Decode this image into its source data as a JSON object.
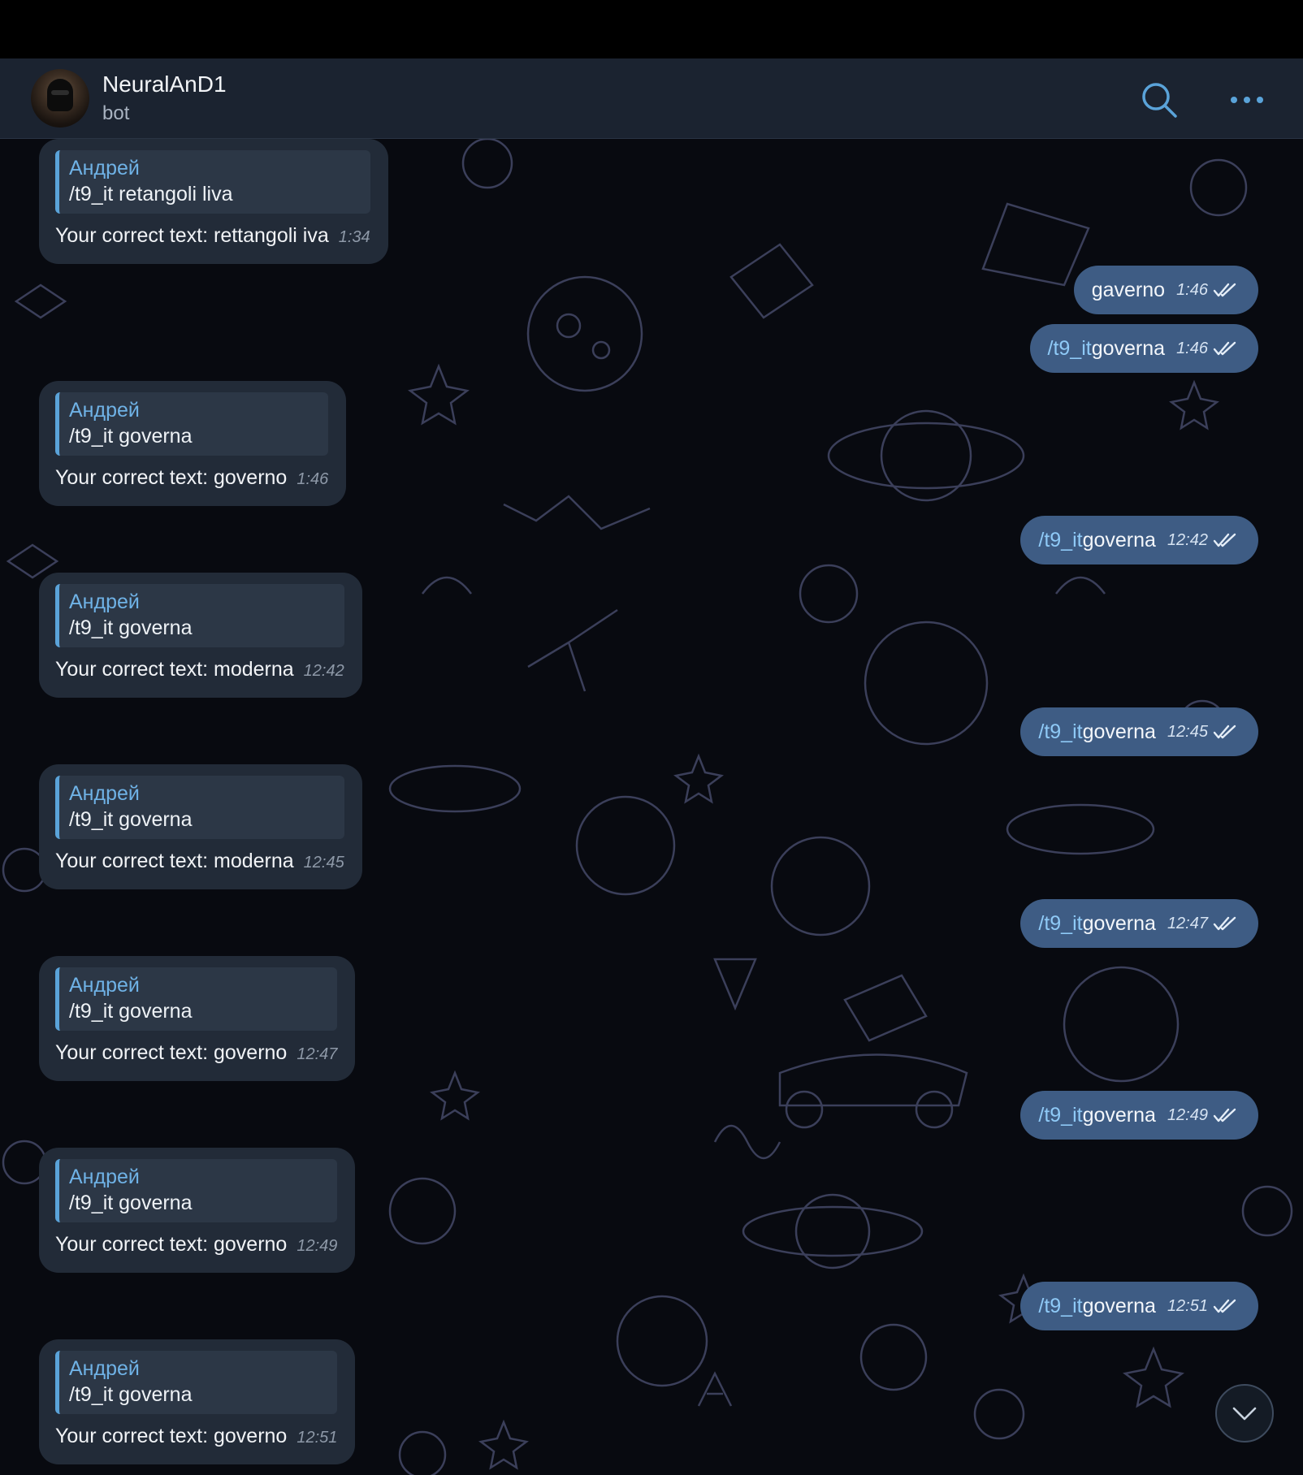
{
  "header": {
    "name": "NeuralAnD1",
    "status": "bot"
  },
  "incoming": [
    {
      "reply_name": "Андрей",
      "reply_text": "/t9_it retangoli liva",
      "text": "Your correct text: rettangoli iva",
      "time": "1:34"
    },
    {
      "reply_name": "Андрей",
      "reply_text": "/t9_it governa",
      "text": "Your correct text: governo",
      "time": "1:46"
    },
    {
      "reply_name": "Андрей",
      "reply_text": "/t9_it governa",
      "text": "Your correct text: moderna",
      "time": "12:42"
    },
    {
      "reply_name": "Андрей",
      "reply_text": "/t9_it governa",
      "text": "Your correct text: moderna",
      "time": "12:45"
    },
    {
      "reply_name": "Андрей",
      "reply_text": "/t9_it governa",
      "text": "Your correct text: governo",
      "time": "12:47"
    },
    {
      "reply_name": "Андрей",
      "reply_text": "/t9_it governa",
      "text": "Your correct text: governo",
      "time": "12:49"
    },
    {
      "reply_name": "Андрей",
      "reply_text": "/t9_it governa",
      "text": "Your correct text: governo",
      "time": "12:51"
    }
  ],
  "outgoing": [
    {
      "command": "",
      "text": "gaverno",
      "time": "1:46"
    },
    {
      "command": "/t9_it",
      "text": " governa",
      "time": "1:46"
    },
    {
      "command": "/t9_it",
      "text": " governa",
      "time": "12:42"
    },
    {
      "command": "/t9_it",
      "text": " governa",
      "time": "12:45"
    },
    {
      "command": "/t9_it",
      "text": " governa",
      "time": "12:47"
    },
    {
      "command": "/t9_it",
      "text": " governa",
      "time": "12:49"
    },
    {
      "command": "/t9_it",
      "text": " governa",
      "time": "12:51"
    }
  ],
  "colors": {
    "header_bg": "#1b2330",
    "incoming_bubble": "#222b38",
    "outgoing_bubble": "#3e5c84",
    "accent": "#5aa3d9",
    "pattern_stroke": "#3b3f5a"
  },
  "icons": {
    "search": "search-icon",
    "more": "more-icon",
    "read_receipt": "double-check-icon",
    "scroll_down": "chevron-down-icon"
  }
}
